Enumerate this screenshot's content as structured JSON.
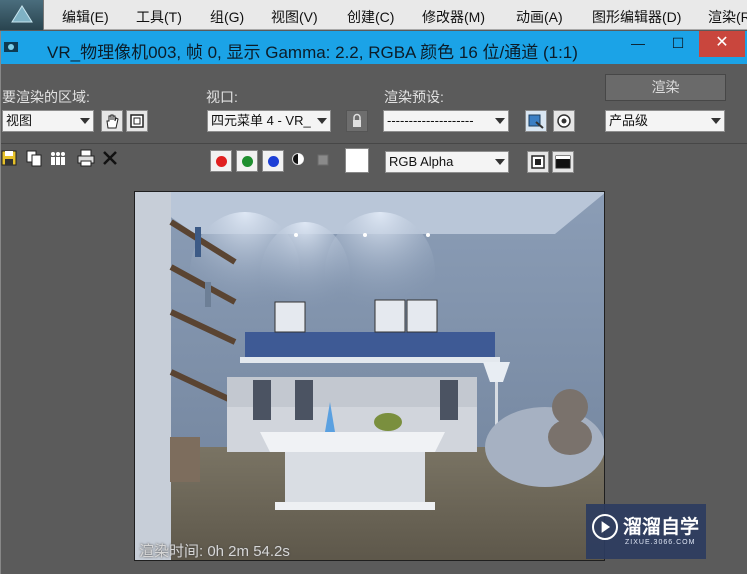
{
  "menubar": {
    "items": [
      "编辑(E)",
      "工具(T)",
      "组(G)",
      "视图(V)",
      "创建(C)",
      "修改器(M)",
      "动画(A)",
      "图形编辑器(D)",
      "渲染(R"
    ]
  },
  "window": {
    "title": "VR_物理像机003, 帧 0, 显示 Gamma: 2.2, RGBA 颜色 16 位/通道 (1:1)",
    "minimize_glyph": "—",
    "maximize_glyph": "☐",
    "close_glyph": "✕"
  },
  "controls": {
    "area_label": "要渲染的区域:",
    "area_value": "视图",
    "viewport_label": "视口:",
    "viewport_value": "四元菜单 4 - VR_",
    "preset_label": "渲染预设:",
    "preset_value": "--------------------",
    "render_button": "渲染",
    "quality_value": "产品级",
    "channel_value": "RGB Alpha"
  },
  "channel_colors": {
    "red": "#e02020",
    "green": "#1f8f2f",
    "blue": "#1d3fd6"
  },
  "icons": [
    "save-icon",
    "copy-icon",
    "clone-icon",
    "print-icon",
    "clear-icon",
    "hand-icon",
    "region-icon",
    "lock-icon",
    "render-setup-icon",
    "environment-icon",
    "mono-icon",
    "toggle-icon",
    "display-icon",
    "frame-window-icon"
  ],
  "render": {
    "time_text": "渲染时间: 0h 2m 54.2s"
  },
  "watermark": {
    "brand": "溜溜自学",
    "url": "ZIXUE.3066.COM"
  },
  "colors": {
    "titlebar": "#1ba3e7",
    "background": "#5b5b5b",
    "close": "#c9463d"
  }
}
